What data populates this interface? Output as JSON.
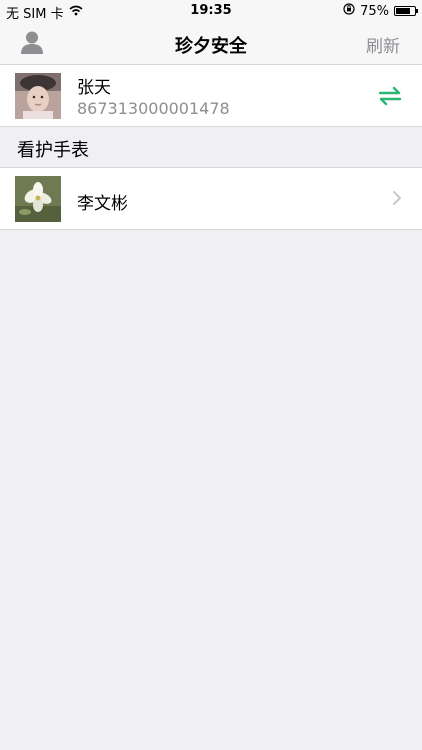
{
  "status_bar": {
    "carrier": "无 SIM 卡",
    "time": "19:35",
    "battery": "75%",
    "battery_level": 0.75
  },
  "nav": {
    "title": "珍夕安全",
    "refresh_label": "刷新"
  },
  "account": {
    "name": "张天",
    "id": "867313000001478"
  },
  "section": {
    "title": "看护手表"
  },
  "watches": [
    {
      "name": "李文彬"
    }
  ],
  "colors": {
    "accent_green": "#2bb673",
    "background": "#efeff4",
    "secondary_text": "#8e8e93"
  },
  "icons": {
    "profile": "person-icon",
    "switch": "switch-arrows-icon",
    "chevron": "chevron-right-icon",
    "wifi": "wifi-icon",
    "lock": "orientation-lock-icon",
    "battery": "battery-icon"
  }
}
